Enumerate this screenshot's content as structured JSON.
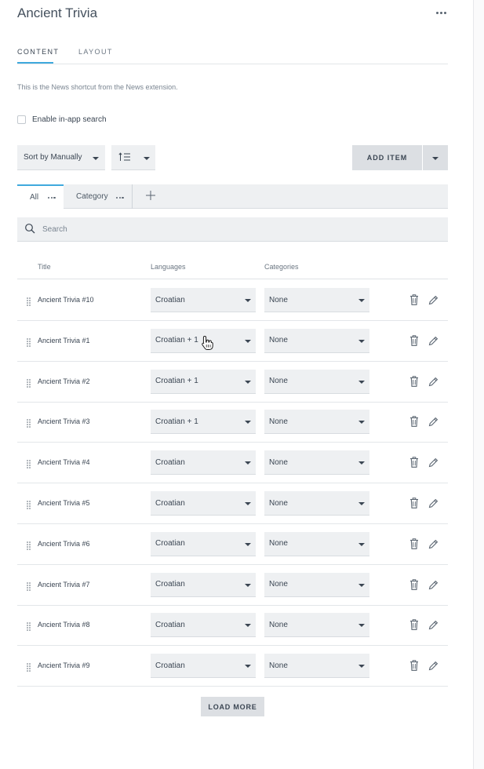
{
  "header": {
    "title": "Ancient Trivia",
    "more_icon": "more-horizontal-icon"
  },
  "tabs": [
    {
      "label": "CONTENT",
      "active": true
    },
    {
      "label": "LAYOUT",
      "active": false
    }
  ],
  "description": "This is the News shortcut from the News extension.",
  "in_app_search": {
    "label": "Enable in-app search",
    "checked": false
  },
  "toolbar": {
    "sort_label": "Sort by Manually",
    "order_icon": "sort-order-icon",
    "add_item_label": "ADD ITEM",
    "add_dropdown_icon": "chevron-down-icon"
  },
  "filter_tabs": [
    {
      "label": "All",
      "active": true
    },
    {
      "label": "Category",
      "active": false
    }
  ],
  "search": {
    "placeholder": "Search",
    "value": ""
  },
  "table": {
    "columns": [
      "Title",
      "Languages",
      "Categories"
    ],
    "rows": [
      {
        "title": "Ancient Trivia #10",
        "language": "Croatian",
        "category": "None"
      },
      {
        "title": "Ancient Trivia #1",
        "language": "Croatian + 1",
        "category": "None"
      },
      {
        "title": "Ancient Trivia #2",
        "language": "Croatian + 1",
        "category": "None"
      },
      {
        "title": "Ancient Trivia #3",
        "language": "Croatian + 1",
        "category": "None"
      },
      {
        "title": "Ancient Trivia #4",
        "language": "Croatian",
        "category": "None"
      },
      {
        "title": "Ancient Trivia #5",
        "language": "Croatian",
        "category": "None"
      },
      {
        "title": "Ancient Trivia #6",
        "language": "Croatian",
        "category": "None"
      },
      {
        "title": "Ancient Trivia #7",
        "language": "Croatian",
        "category": "None"
      },
      {
        "title": "Ancient Trivia #8",
        "language": "Croatian",
        "category": "None"
      },
      {
        "title": "Ancient Trivia #9",
        "language": "Croatian",
        "category": "None"
      }
    ]
  },
  "load_more_label": "LOAD MORE",
  "colors": {
    "accent": "#3fa9dd",
    "text": "#3b4653",
    "field_bg": "#eef0f2",
    "button_bg": "#dcdfe3"
  }
}
